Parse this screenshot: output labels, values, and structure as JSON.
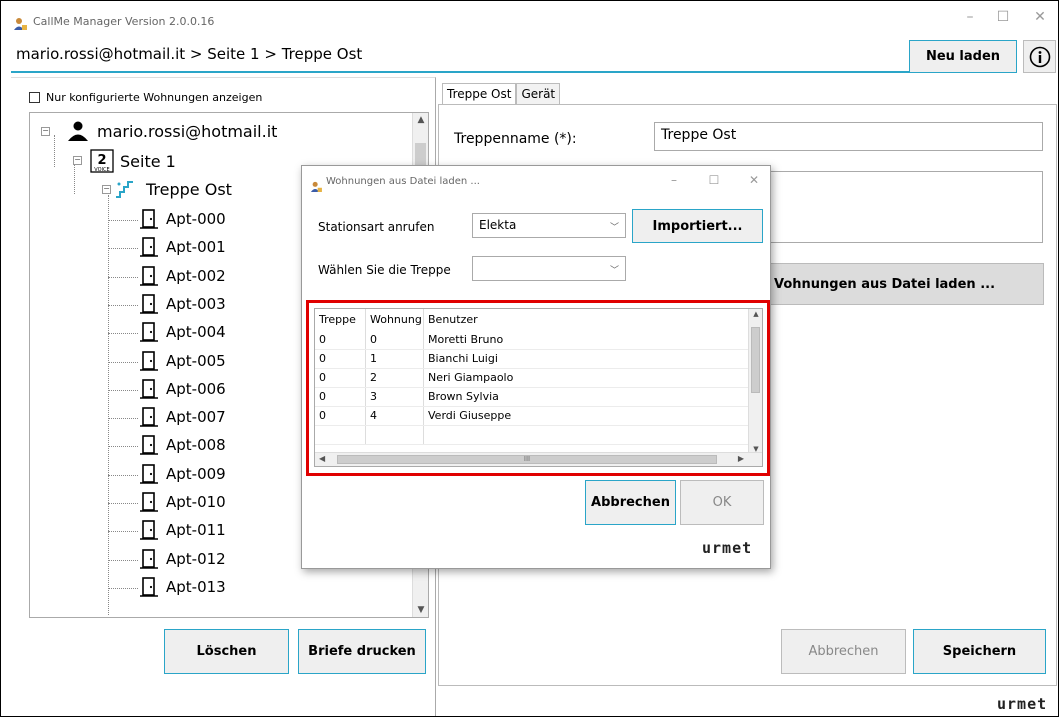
{
  "window": {
    "title": "CallMe Manager Version 2.0.0.16",
    "controls": {
      "minimize": "–",
      "maximize": "☐",
      "close": "✕"
    }
  },
  "header": {
    "breadcrumb": "mario.rossi@hotmail.it > Seite 1 > Treppe Ost",
    "reload_label": "Neu laden",
    "info_icon": "info-icon"
  },
  "left": {
    "filter_checkbox_label": "Nur konfigurierte Wohnungen anzeigen",
    "tree": {
      "account": "mario.rossi@hotmail.it",
      "page": "Seite 1",
      "stair": "Treppe Ost",
      "apartments": [
        "Apt-000",
        "Apt-001",
        "Apt-002",
        "Apt-003",
        "Apt-004",
        "Apt-005",
        "Apt-006",
        "Apt-007",
        "Apt-008",
        "Apt-009",
        "Apt-010",
        "Apt-011",
        "Apt-012",
        "Apt-013"
      ]
    },
    "delete_label": "Löschen",
    "print_label": "Briefe drucken"
  },
  "right": {
    "tabs": [
      "Treppe Ost",
      "Gerät"
    ],
    "stair_name_label": "Treppenname (*):",
    "stair_name_value": "Treppe Ost",
    "load_button_visible": "Vohnungen aus Datei laden ...",
    "cancel_label": "Abbrechen",
    "save_label": "Speichern",
    "brand": "urmet"
  },
  "dialog": {
    "title": "Wohnungen aus Datei laden ...",
    "controls": {
      "minimize": "–",
      "maximize": "☐",
      "close": "✕"
    },
    "station_label": "Stationsart anrufen",
    "station_value": "Elekta",
    "import_label": "Importiert...",
    "stair_label": "Wählen Sie die Treppe",
    "stair_value": "",
    "grid": {
      "columns": [
        "Treppe",
        "Wohnung",
        "Benutzer"
      ],
      "rows": [
        [
          "0",
          "0",
          "Moretti Bruno"
        ],
        [
          "0",
          "1",
          "Bianchi Luigi"
        ],
        [
          "0",
          "2",
          "Neri Giampaolo"
        ],
        [
          "0",
          "3",
          "Brown Sylvia"
        ],
        [
          "0",
          "4",
          "Verdi Giuseppe"
        ]
      ],
      "hscroll_grip": "III"
    },
    "cancel_label": "Abbrechen",
    "ok_label": "OK",
    "brand": "urmet"
  },
  "colors": {
    "accent": "#2aa5c8",
    "highlight": "#e00000",
    "stair_icon": "#2aa5c8"
  }
}
